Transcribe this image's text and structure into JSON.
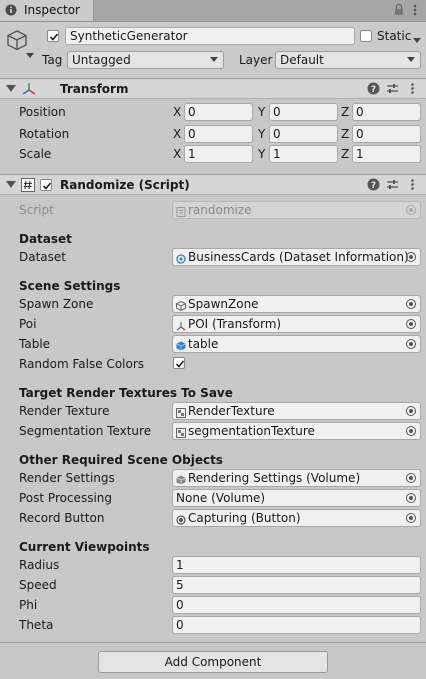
{
  "tab": {
    "icon": "info-icon",
    "title": "Inspector"
  },
  "object": {
    "icon": "cube-icon",
    "name": "SyntheticGenerator",
    "active": true,
    "static_label": "Static",
    "static_checked": false,
    "tag_label": "Tag",
    "tag_value": "Untagged",
    "layer_label": "Layer",
    "layer_value": "Default"
  },
  "transform": {
    "title": "Transform",
    "icon": "transform-axes-icon",
    "rows": [
      {
        "label": "Position",
        "x": "0",
        "y": "0",
        "z": "0"
      },
      {
        "label": "Rotation",
        "x": "0",
        "y": "0",
        "z": "0"
      },
      {
        "label": "Scale",
        "x": "1",
        "y": "1",
        "z": "1"
      }
    ],
    "axis_labels": {
      "x": "X",
      "y": "Y",
      "z": "Z"
    }
  },
  "script": {
    "title": "Randomize (Script)",
    "icon": "script-hash-icon",
    "enabled": true,
    "script_label": "Script",
    "script_value": "randomize",
    "sections": {
      "dataset": "Dataset",
      "scene": "Scene Settings",
      "textures": "Target Render Textures To Save",
      "required": "Other Required Scene Objects",
      "viewpoints": "Current Viewpoints"
    },
    "fields": {
      "dataset": {
        "label": "Dataset",
        "value": "BusinessCards (Dataset Information)"
      },
      "spawn_zone": {
        "label": "Spawn Zone",
        "value": "SpawnZone"
      },
      "poi": {
        "label": "Poi",
        "value": "POI (Transform)"
      },
      "table": {
        "label": "Table",
        "value": "table"
      },
      "random_false_colors": {
        "label": "Random False Colors",
        "checked": true
      },
      "render_texture": {
        "label": "Render Texture",
        "value": "RenderTexture"
      },
      "segmentation_texture": {
        "label": "Segmentation Texture",
        "value": "segmentationTexture"
      },
      "render_settings": {
        "label": "Render Settings",
        "value": "Rendering Settings (Volume)"
      },
      "post_processing": {
        "label": "Post Processing",
        "value": "None (Volume)"
      },
      "record_button": {
        "label": "Record Button",
        "value": "Capturing (Button)"
      },
      "radius": {
        "label": "Radius",
        "value": "1"
      },
      "speed": {
        "label": "Speed",
        "value": "5"
      },
      "phi": {
        "label": "Phi",
        "value": "0"
      },
      "theta": {
        "label": "Theta",
        "value": "0"
      }
    }
  },
  "footer": {
    "add_component": "Add Component"
  },
  "colors": {
    "panel": "#c8c8c8",
    "header": "#d6d6d6",
    "field": "#f0f0f0",
    "accent_blue": "#2f7fd6"
  }
}
